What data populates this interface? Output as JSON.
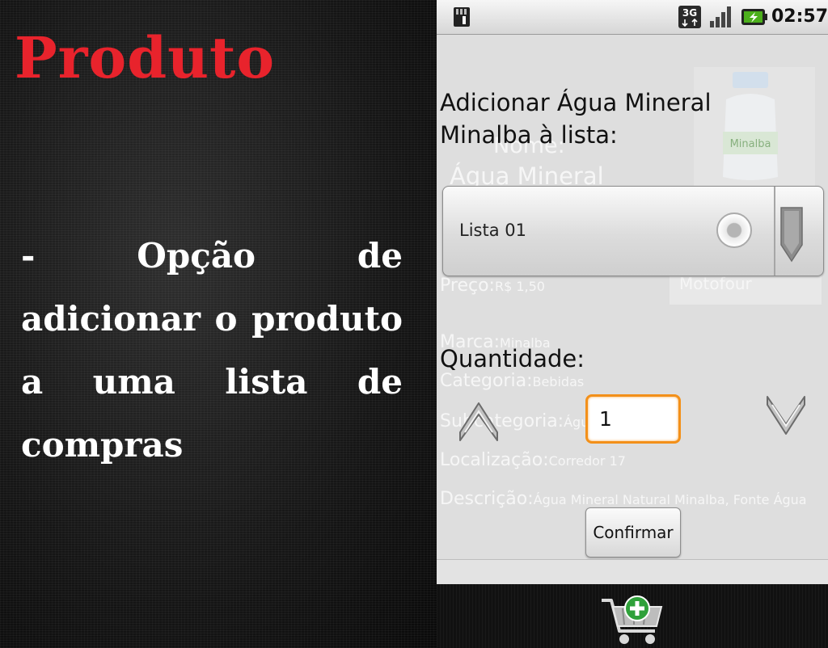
{
  "slide": {
    "title": "Produto",
    "body": "- Opção de adicionar o produto a uma lista de compras"
  },
  "status_bar": {
    "time": "02:57",
    "network": "3G",
    "icons": [
      "sd-card-icon",
      "network-3g-icon",
      "signal-icon",
      "battery-charging-icon"
    ]
  },
  "background_form": {
    "nome_label": "Nome:",
    "nome_value": "Água Mineral",
    "preco_label": "Preço:",
    "preco_value": "R$ 1,50",
    "store_select": "Motofour",
    "marca_label": "Marca:",
    "marca_value": "Minalba",
    "categoria_label": "Categoria:",
    "categoria_value": "Bebidas",
    "subcategoria_label": "Subcategoria:",
    "subcategoria_value": "Água",
    "localizacao_label": "Localização:",
    "localizacao_value": "Corredor 17",
    "descricao_label": "Descrição:",
    "descricao_value": "Água Mineral Natural Minalba, Fonte Água"
  },
  "dialog": {
    "title": "Adicionar Água Mineral Minalba à lista:",
    "list_spinner": {
      "selected": "Lista 01"
    },
    "quantity_label": "Quantidade:",
    "quantity_value": "1",
    "confirm_label": "Confirmar"
  },
  "bottom_bar": {
    "icon": "add-to-cart-icon"
  },
  "colors": {
    "title_red": "#e8232c",
    "focus_orange": "#f39019"
  }
}
